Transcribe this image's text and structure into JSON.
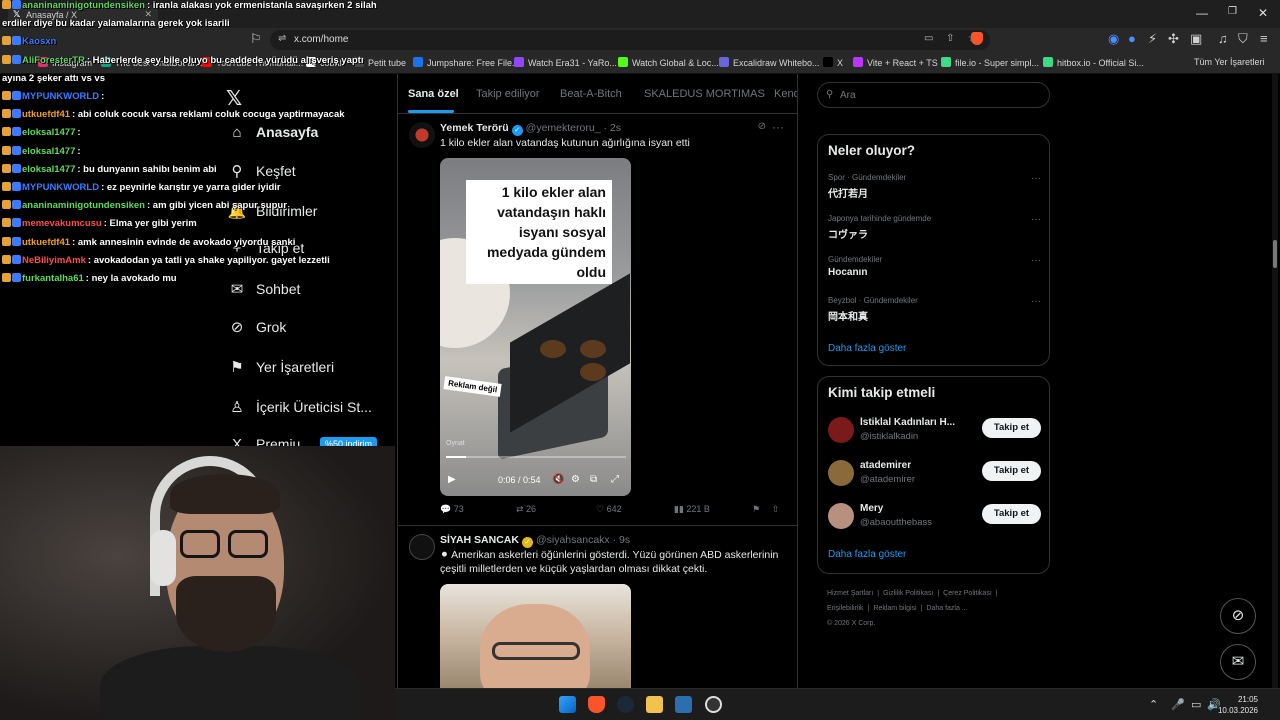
{
  "browser": {
    "tab_title": "Anasayfa / X",
    "url": "x.com/home",
    "bookmarks": [
      {
        "label": "Instagram",
        "color": "#e1306c"
      },
      {
        "label": "The best ChatBot an...",
        "color": "#10a37f"
      },
      {
        "label": "YouTube Thumbnail...",
        "color": "#ff0000"
      },
      {
        "label": "cobalt",
        "color": "#ffffff"
      },
      {
        "label": "Petit tube",
        "color": "#444444"
      },
      {
        "label": "Jumpshare: Free File...",
        "color": "#1a73e8"
      },
      {
        "label": "Watch Era31 - YaRo...",
        "color": "#9146ff"
      },
      {
        "label": "Watch Global & Loc...",
        "color": "#53fc18"
      },
      {
        "label": "Excalidraw Whitebo...",
        "color": "#6965db"
      },
      {
        "label": "X",
        "color": "#000000"
      },
      {
        "label": "Vite + React + TS",
        "color": "#bd34fe"
      },
      {
        "label": "file.io - Super simpl...",
        "color": "#3ddc84"
      },
      {
        "label": "hitbox.io - Official Si...",
        "color": "#3ddc84"
      }
    ],
    "all_bookmarks": "Tüm Yer İşaretleri"
  },
  "sidebar": {
    "items": [
      {
        "label": "Anasayfa",
        "icon": "home-icon",
        "glyph": "⌂"
      },
      {
        "label": "Keşfet",
        "icon": "search-icon",
        "glyph": "⚲"
      },
      {
        "label": "Bildirimler",
        "icon": "bell-icon",
        "glyph": "🔔"
      },
      {
        "label": "Takip et",
        "icon": "add-person-icon",
        "glyph": "+"
      },
      {
        "label": "Sohbet",
        "icon": "mail-icon",
        "glyph": "✉"
      },
      {
        "label": "Grok",
        "icon": "grok-icon",
        "glyph": "⊘"
      },
      {
        "label": "Yer İşaretleri",
        "icon": "bookmark-icon",
        "glyph": "⚑"
      },
      {
        "label": "İçerik Üreticisi St...",
        "icon": "creator-icon",
        "glyph": "♙"
      },
      {
        "label": "Premiu...",
        "icon": "x-premium-icon",
        "glyph": "X"
      }
    ],
    "premium_badge": "%50 indirim",
    "fragment_labels": [
      "l",
      "zla"
    ]
  },
  "timeline": {
    "tabs": [
      "Sana özel",
      "Takip ediliyor",
      "Beat-A-Bitch",
      "SKALEDUS MORTIMAS",
      "Kend"
    ],
    "tweets": [
      {
        "name": "Yemek Terörü",
        "handle": "@yemekteroru_ · 2s",
        "text": "1 kilo ekler alan vatandaş kutunun ağırlığına isyan etti",
        "media_caption": "1 kilo ekler alan vatandaşın haklı isyanı sosyal medyada gündem oldu",
        "media_tag": "Reklam değil",
        "play_hint": "Oynat",
        "video_time": "0:06 / 0:54",
        "video_progress": 0.11,
        "replies": "73",
        "reposts": "26",
        "likes": "642",
        "views": "221 B"
      },
      {
        "name": "SİYAH SANCAK",
        "handle": "@siyahsancakx · 9s",
        "text": "⚫ Amerikan askerleri öğünlerini gösterdi. Yüzü görünen ABD askerlerinin çeşitli milletlerden ve küçük yaşlardan olması dikkat çekti."
      }
    ]
  },
  "right": {
    "search_placeholder": "Ara",
    "trends_title": "Neler oluyor?",
    "trends": [
      {
        "meta": "Spor · Gündemdekiler",
        "topic": "代打若月"
      },
      {
        "meta": "Japonya tarihinde gündemde",
        "topic": "コヴァラ"
      },
      {
        "meta": "Gündemdekiler",
        "topic": "Hocanın"
      },
      {
        "meta": "Beyzbol · Gündemdekiler",
        "topic": "岡本和真"
      }
    ],
    "trends_more": "Daha fazla göster",
    "follow_title": "Kimi takip etmeli",
    "follow": [
      {
        "name": "İstiklal Kadınları H...",
        "handle": "@istiklalkadin",
        "color": "#7a1a1a"
      },
      {
        "name": "atademirer",
        "handle": "@atademirer",
        "color": "#8a6a3a"
      },
      {
        "name": "Mery",
        "handle": "@abaoutthebass",
        "color": "#b89080"
      }
    ],
    "follow_button": "Takip et",
    "follow_more": "Daha fazla göster",
    "footer": [
      "Hizmet Şartları",
      "|",
      "Gizlilik Politikası",
      "|",
      "Çerez Politikası",
      "|",
      "Erişilebilirlik",
      "|",
      "Reklam bilgisi",
      "|",
      "Daha fazla ...",
      "© 2026 X Corp."
    ]
  },
  "chat": [
    {
      "user": "ananinaminigotundensiken",
      "color": "#5cdb5c",
      "msg": ": iranla alakası yok ermenistanla savaşırken 2 silah"
    },
    {
      "user": "",
      "color": "#ffffff",
      "msg": "erdiler diye bu kadar yalamalarına gerek yok isarili"
    },
    {
      "user": "Kaosxn",
      "color": "#3a7bff",
      "msg": ""
    },
    {
      "user": "AliForesterTR",
      "color": "#5cdb5c",
      "msg": ": Haberlerde şey bile oluyo bu caddede yürüdü alışveriş yaptı"
    },
    {
      "user": "",
      "color": "#ffffff",
      "msg": "ayına 2 şeker attı vs vs"
    },
    {
      "user": "MYPUNKWORLD",
      "color": "#3a7bff",
      "msg": ":"
    },
    {
      "user": "utkuefdf41",
      "color": "#f0a020",
      "msg": ": abi coluk cocuk varsa reklami coluk cocuga yaptirmayacak"
    },
    {
      "user": "eloksal1477",
      "color": "#5cdb5c",
      "msg": ":"
    },
    {
      "user": "eloksal1477",
      "color": "#5cdb5c",
      "msg": ":"
    },
    {
      "user": "eloksal1477",
      "color": "#5cdb5c",
      "msg": ": bu dunyanın sahibı benim abi"
    },
    {
      "user": "MYPUNKWORLD",
      "color": "#3a7bff",
      "msg": ": ez peynirle karıştır ye yarra gider iyidir"
    },
    {
      "user": "ananinaminigotundensiken",
      "color": "#5cdb5c",
      "msg": ": am gibi yicen abi şapur şupur"
    },
    {
      "user": "memevakumcusu",
      "color": "#ff4a4a",
      "msg": ": Elma yer gibi yerim"
    },
    {
      "user": "utkuefdf41",
      "color": "#f0a020",
      "msg": ": amk annesinin evinde de avokado yiyordu sanki"
    },
    {
      "user": "NeBiliyimAmk",
      "color": "#ff4a4a",
      "msg": ": avokadodan ya tatli ya shake yapiliyor. gayet lezzetli"
    },
    {
      "user": "furkantalha61",
      "color": "#5cdb5c",
      "msg": ": ney la avokado mu"
    }
  ],
  "taskbar": {
    "time": "21:05",
    "date": "10.03.2026"
  }
}
